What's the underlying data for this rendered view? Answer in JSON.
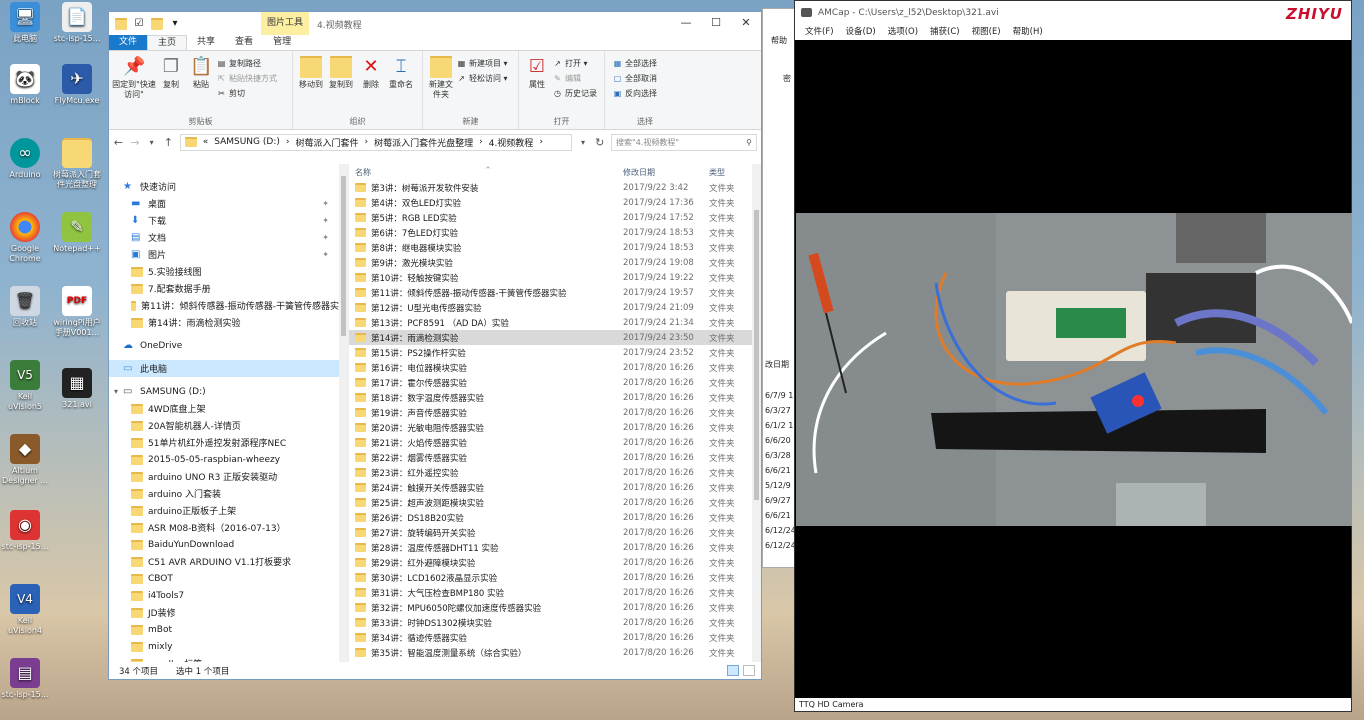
{
  "desktop_icons": [
    {
      "label": "此电脑",
      "top": 0
    },
    {
      "label": "stc-isp-15...",
      "top": 0
    },
    {
      "label": "mBlock",
      "top": 0
    },
    {
      "label": "FlyMcu.exe",
      "top": 0
    },
    {
      "label": "Arduino",
      "top": 0
    },
    {
      "label": "树莓派入门套件光盘整理",
      "top": 0
    },
    {
      "label": "Google Chrome",
      "top": 0
    },
    {
      "label": "Notepad++",
      "top": 0
    },
    {
      "label": "回收站",
      "top": 0
    },
    {
      "label": "wiringPi用户手册V001...",
      "top": 0
    },
    {
      "label": "Keil uVision5",
      "top": 0
    },
    {
      "label": "321.avi",
      "top": 0
    },
    {
      "label": "Altium Designer ...",
      "top": 0
    },
    {
      "label": "stc-isp-15...",
      "top": 0
    },
    {
      "label": "Keil uVision4",
      "top": 0
    },
    {
      "label": "stc-isp-15...",
      "top": 0
    }
  ],
  "explorer": {
    "context_tab": "图片工具",
    "window_title": "4.视频教程",
    "tabs": {
      "file": "文件",
      "home": "主页",
      "share": "共享",
      "view": "查看",
      "manage": "管理"
    },
    "ribbon": {
      "pin_quick": "固定到\"快速访问\"",
      "copy": "复制",
      "paste": "粘贴",
      "copy_path": "复制路径",
      "paste_shortcut": "粘贴快捷方式",
      "cut": "剪切",
      "clipboard": "剪贴板",
      "move_to": "移动到",
      "copy_to": "复制到",
      "delete": "删除",
      "rename": "重命名",
      "organize": "组织",
      "new_folder": "新建文件夹",
      "new_item": "新建项目",
      "easy_access": "轻松访问",
      "new_group": "新建",
      "properties": "属性",
      "open": "打开",
      "edit": "编辑",
      "history": "历史记录",
      "open_group": "打开",
      "select_all": "全部选择",
      "select_none": "全部取消",
      "invert": "反向选择",
      "select_group": "选择"
    },
    "address": {
      "path": [
        "SAMSUNG (D:)",
        "树莓派入门套件",
        "树莓派入门套件光盘整理",
        "4.视频教程"
      ],
      "search_placeholder": "搜索\"4.视频教程\""
    },
    "nav": {
      "quick_access": "快速访问",
      "pinned": [
        "桌面",
        "下载",
        "文档",
        "图片"
      ],
      "recent": [
        "5.实验接线图",
        "7.配套数据手册",
        "第11讲：倾斜传感器-振动传感器-干簧管传感器实",
        "第14讲：雨滴检测实验"
      ],
      "onedrive": "OneDrive",
      "this_pc": "此电脑",
      "drive": "SAMSUNG (D:)",
      "drive_folders": [
        "4WD底盘上架",
        "20A智能机器人-详情页",
        "51单片机红外遥控发射源程序NEC",
        "2015-05-05-raspbian-wheezy",
        "arduino UNO R3 正版安装驱动",
        "arduino 入门套装",
        "arduino正版板子上架",
        "ASR M08-B资料（2016-07-13）",
        "BaiduYunDownload",
        "C51 AVR ARDUINO V1.1打板要求",
        "CBOT",
        "i4Tools7",
        "JD装修",
        "mBot",
        "mixly",
        "parallax标签"
      ]
    },
    "columns": {
      "name": "名称",
      "date": "修改日期",
      "type": "类型"
    },
    "files": [
      {
        "name": "第3讲：树莓派开发软件安装",
        "date": "2017/9/22 3:42",
        "type": "文件夹"
      },
      {
        "name": "第4讲：双色LED灯实验",
        "date": "2017/9/24 17:36",
        "type": "文件夹"
      },
      {
        "name": "第5讲：RGB LED实验",
        "date": "2017/9/24 17:52",
        "type": "文件夹"
      },
      {
        "name": "第6讲：7色LED灯实验",
        "date": "2017/9/24 18:53",
        "type": "文件夹"
      },
      {
        "name": "第8讲：继电器模块实验",
        "date": "2017/9/24 18:53",
        "type": "文件夹"
      },
      {
        "name": "第9讲：激光模块实验",
        "date": "2017/9/24 19:08",
        "type": "文件夹"
      },
      {
        "name": "第10讲：轻触按键实验",
        "date": "2017/9/24 19:22",
        "type": "文件夹"
      },
      {
        "name": "第11讲：倾斜传感器-振动传感器-干簧管传感器实验",
        "date": "2017/9/24 19:57",
        "type": "文件夹"
      },
      {
        "name": "第12讲：U型光电传感器实验",
        "date": "2017/9/24 21:09",
        "type": "文件夹"
      },
      {
        "name": "第13讲：PCF8591 （AD DA）实验",
        "date": "2017/9/24 21:34",
        "type": "文件夹"
      },
      {
        "name": "第14讲：雨滴检测实验",
        "date": "2017/9/24 23:50",
        "type": "文件夹"
      },
      {
        "name": "第15讲：PS2操作杆实验",
        "date": "2017/9/24 23:52",
        "type": "文件夹"
      },
      {
        "name": "第16讲：电位器模块实验",
        "date": "2017/8/20 16:26",
        "type": "文件夹"
      },
      {
        "name": "第17讲：霍尔传感器实验",
        "date": "2017/8/20 16:26",
        "type": "文件夹"
      },
      {
        "name": "第18讲：数字温度传感器实验",
        "date": "2017/8/20 16:26",
        "type": "文件夹"
      },
      {
        "name": "第19讲：声音传感器实验",
        "date": "2017/8/20 16:26",
        "type": "文件夹"
      },
      {
        "name": "第20讲：光敏电阻传感器实验",
        "date": "2017/8/20 16:26",
        "type": "文件夹"
      },
      {
        "name": "第21讲：火焰传感器实验",
        "date": "2017/8/20 16:26",
        "type": "文件夹"
      },
      {
        "name": "第22讲：烟雾传感器实验",
        "date": "2017/8/20 16:26",
        "type": "文件夹"
      },
      {
        "name": "第23讲：红外遥控实验",
        "date": "2017/8/20 16:26",
        "type": "文件夹"
      },
      {
        "name": "第24讲：触摸开关传感器实验",
        "date": "2017/8/20 16:26",
        "type": "文件夹"
      },
      {
        "name": "第25讲：超声波测距模块实验",
        "date": "2017/8/20 16:26",
        "type": "文件夹"
      },
      {
        "name": "第26讲：DS18B20实验",
        "date": "2017/8/20 16:26",
        "type": "文件夹"
      },
      {
        "name": "第27讲：旋转编码开关实验",
        "date": "2017/8/20 16:26",
        "type": "文件夹"
      },
      {
        "name": "第28讲：温度传感器DHT11 实验",
        "date": "2017/8/20 16:26",
        "type": "文件夹"
      },
      {
        "name": "第29讲：红外避障模块实验",
        "date": "2017/8/20 16:26",
        "type": "文件夹"
      },
      {
        "name": "第30讲：LCD1602液晶显示实验",
        "date": "2017/8/20 16:26",
        "type": "文件夹"
      },
      {
        "name": "第31讲：大气压检查BMP180 实验",
        "date": "2017/8/20 16:26",
        "type": "文件夹"
      },
      {
        "name": "第32讲：MPU6050陀螺仪加速度传感器实验",
        "date": "2017/8/20 16:26",
        "type": "文件夹"
      },
      {
        "name": "第33讲：时钟DS1302模块实验",
        "date": "2017/8/20 16:26",
        "type": "文件夹"
      },
      {
        "name": "第34讲：循迹传感器实验",
        "date": "2017/8/20 16:26",
        "type": "文件夹"
      },
      {
        "name": "第35讲：智能温度测量系统（综合实验）",
        "date": "2017/8/20 16:26",
        "type": "文件夹"
      }
    ],
    "selected_row": 10,
    "status": {
      "count": "34 个项目",
      "selected": "选中 1 个项目"
    }
  },
  "amcap": {
    "title": "AMCap - C:\\Users\\z_l52\\Desktop\\321.avi",
    "menu": [
      "文件(F)",
      "设备(D)",
      "选项(O)",
      "捕获(C)",
      "视图(E)",
      "帮助(H)"
    ],
    "status": "TTQ HD Camera",
    "logo": "ZHIYU"
  },
  "behind_window": {
    "col_header": "改日期",
    "dates": [
      "6/7/9 1",
      "6/3/27",
      "6/1/2 1",
      "6/6/20",
      "6/3/28",
      "6/6/21",
      "5/12/9",
      "6/9/27",
      "6/6/21",
      "6/12/24",
      "6/12/24"
    ],
    "labels": [
      "帮助",
      "密"
    ]
  }
}
